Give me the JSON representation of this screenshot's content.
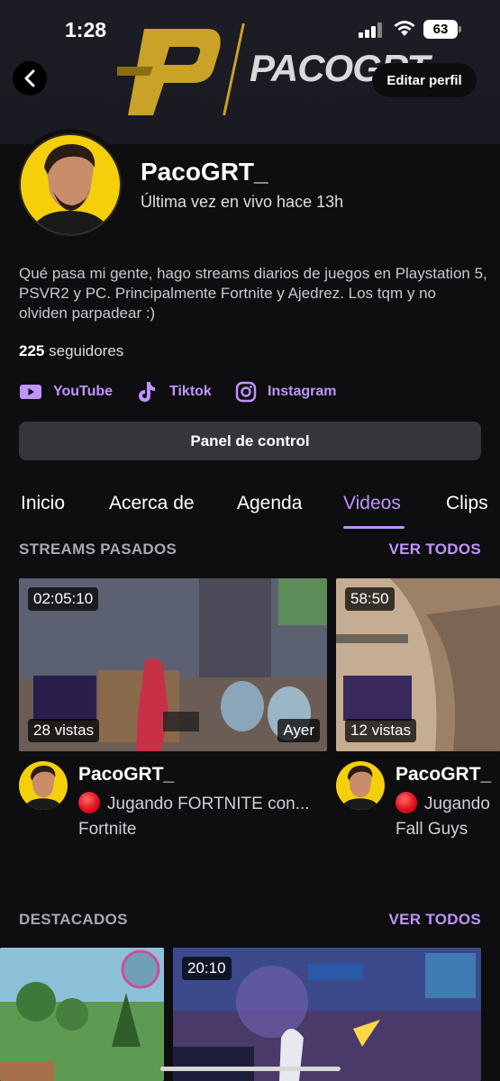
{
  "status_bar": {
    "time": "1:28",
    "battery": "63"
  },
  "banner": {
    "logo_text": "PACOGRT"
  },
  "header": {
    "edit_profile": "Editar perfil"
  },
  "profile": {
    "username": "PacoGRT_",
    "last_live": "Última vez en vivo hace 13h",
    "bio": "Qué pasa mi gente, hago streams diarios de juegos en Playstation 5, PSVR2 y PC. Principalmente Fortnite y Ajedrez. Los tqm y no olviden parpadear :)",
    "followers_count": "225",
    "followers_label": "seguidores"
  },
  "social": [
    {
      "label": "YouTube",
      "icon": "youtube-icon"
    },
    {
      "label": "Tiktok",
      "icon": "tiktok-icon"
    },
    {
      "label": "Instagram",
      "icon": "instagram-icon"
    }
  ],
  "panel_button": "Panel de control",
  "tabs": [
    {
      "label": "Inicio"
    },
    {
      "label": "Acerca de"
    },
    {
      "label": "Agenda"
    },
    {
      "label": "Videos",
      "active": true
    },
    {
      "label": "Clips"
    }
  ],
  "past_streams": {
    "title": "STREAMS PASADOS",
    "see_all": "VER TODOS",
    "videos": [
      {
        "duration": "02:05:10",
        "views": "28 vistas",
        "date": "Ayer",
        "channel": "PacoGRT_",
        "title": "Jugando FORTNITE con...",
        "game": "Fortnite"
      },
      {
        "duration": "58:50",
        "views": "12 vistas",
        "channel": "PacoGRT_",
        "title": "Jugando",
        "game": "Fall Guys"
      }
    ]
  },
  "highlights": {
    "title": "DESTACADOS",
    "see_all": "VER TODOS",
    "videos": [
      {
        "duration": ""
      },
      {
        "duration": "20:10"
      }
    ]
  },
  "colors": {
    "accent": "#bf94ff",
    "background": "#0e0e10",
    "avatar_bg": "#f5cf0a",
    "logo_gold": "#c9a227"
  }
}
